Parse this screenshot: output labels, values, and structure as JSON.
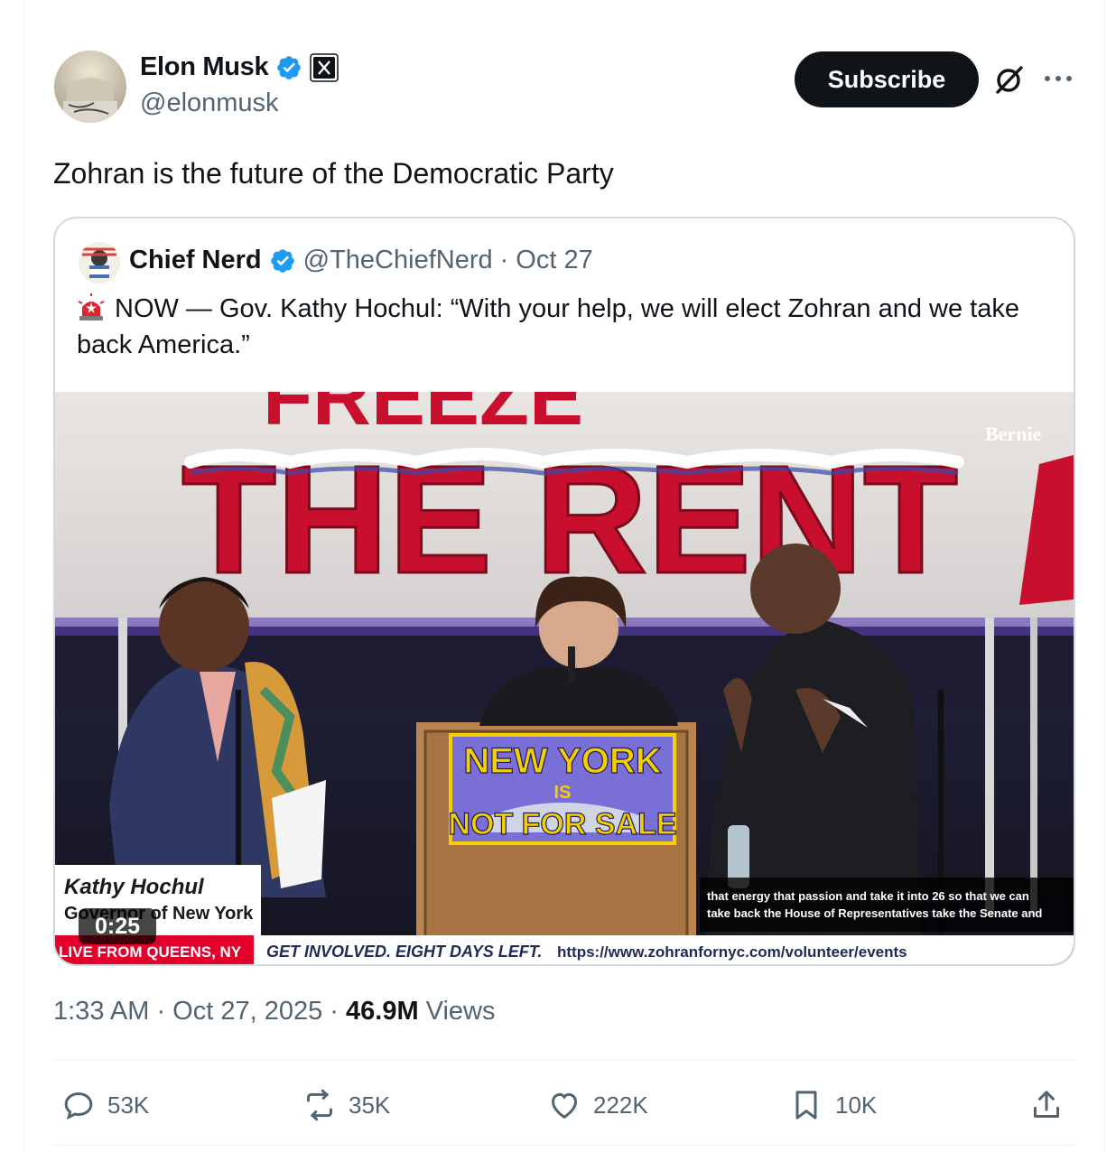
{
  "post": {
    "author_name": "Elon Musk",
    "author_handle": "@elonmusk",
    "subscribe_label": "Subscribe",
    "text": "Zohran is the future of the Democratic Party",
    "timestamp": "1:33 AM · Oct 27, 2025 · ",
    "views_count": "46.9M",
    "views_label": " Views"
  },
  "quote": {
    "author_name": "Chief Nerd",
    "author_handle": "@TheChiefNerd",
    "separator": "·",
    "date": "Oct 27",
    "text": "NOW — Gov. Kathy Hochul: “With your help, we will elect Zohran and we take back America.”",
    "video": {
      "duration": "0:25",
      "banner_line1": "THE RENT",
      "banner_top_partial": "FREEZE",
      "watermark": "Bernie",
      "podium_line1": "NEW YORK",
      "podium_line2": "IS",
      "podium_line3": "NOT FOR SALE",
      "lower_third_name": "Kathy Hochul",
      "lower_third_title": "Governor of New York",
      "live_label": "LIVE FROM QUEENS, NY",
      "ticker_text": "GET INVOLVED. EIGHT DAYS LEFT.",
      "ticker_url": "https://www.zohranfornyc.com/volunteer/events",
      "caption_line1": "that energy that passion and take it into 26 so that we can",
      "caption_line2": "take back the House of Representatives take the Senate and"
    }
  },
  "actions": {
    "replies": "53K",
    "reposts": "35K",
    "likes": "222K",
    "bookmarks": "10K"
  },
  "colors": {
    "verified": "#1d9bf0",
    "text_primary": "#0f1419",
    "text_secondary": "#536471",
    "border": "#cfd9de",
    "banner_red": "#c8102e",
    "live_red": "#e3002b"
  },
  "icons": [
    "verified-badge-icon",
    "x-affiliate-icon",
    "grok-icon",
    "more-icon",
    "siren-icon",
    "reply-icon",
    "repost-icon",
    "like-icon",
    "bookmark-icon",
    "share-icon"
  ]
}
